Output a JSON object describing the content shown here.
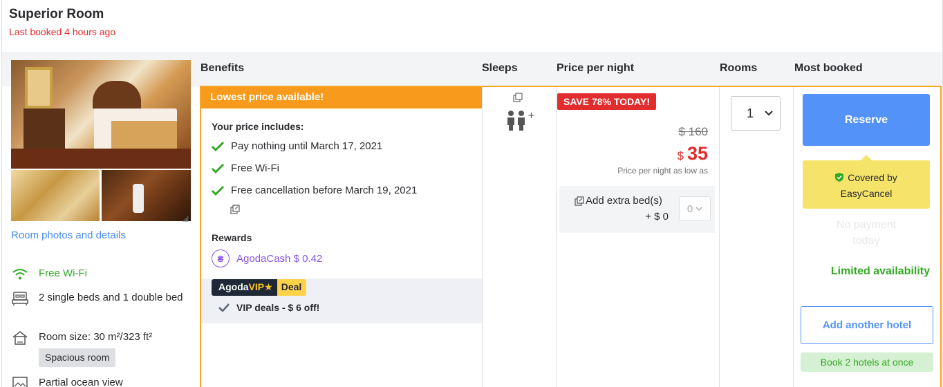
{
  "room": {
    "title": "Superior Room",
    "last_booked": "Last booked 4 hours ago"
  },
  "columns": {
    "benefits": "Benefits",
    "sleeps": "Sleeps",
    "price": "Price per night",
    "rooms": "Rooms",
    "most_booked": "Most booked"
  },
  "photos": {
    "link": "Room photos and details"
  },
  "features": [
    {
      "icon": "wifi-icon",
      "text": "Free Wi-Fi"
    },
    {
      "icon": "bed-icon",
      "text": "2 single beds and 1 double bed"
    },
    {
      "icon": "room-size-icon",
      "text": "Room size: 30 m²/323 ft²",
      "chip": "Spacious room"
    },
    {
      "icon": "ocean-view-icon",
      "text": "Partial ocean view"
    }
  ],
  "offer": {
    "banner": "Lowest price available!",
    "includes_title": "Your price includes:",
    "includes": [
      "Pay nothing until March 17, 2021",
      "Free Wi-Fi",
      "Free cancellation before March 19, 2021"
    ],
    "rewards_title": "Rewards",
    "agoda_cash": "AgodaCash $ 0.42",
    "vip_badge": {
      "agoda": "Agoda",
      "vip": "VIP",
      "deal": "Deal"
    },
    "vip_deal": "VIP deals - $ 6 off!"
  },
  "price": {
    "save_badge": "SAVE 78% TODAY!",
    "original": "$ 160",
    "currency": "$",
    "current": "35",
    "note": "Price per night as low as",
    "extra_bed_label": "Add extra bed(s)",
    "extra_bed_price": "+ $ 0",
    "extra_bed_value": "0"
  },
  "rooms": {
    "selected": "1"
  },
  "booking": {
    "reserve": "Reserve",
    "easy_cancel_line1": "Covered by",
    "easy_cancel_line2": "EasyCancel",
    "no_payment_line1": "No payment",
    "no_payment_line2": "today",
    "limited": "Limited availability",
    "add_hotel": "Add another hotel",
    "book_two": "Book 2 hotels at once"
  },
  "colors": {
    "accent_orange": "#f6a623",
    "banner_orange": "#f89b1c",
    "price_red": "#e12d2d",
    "link_blue": "#488bf8",
    "button_blue": "#5392f9",
    "green": "#32a923",
    "purple": "#8a54e8",
    "easy_yellow": "#f6e46a"
  }
}
